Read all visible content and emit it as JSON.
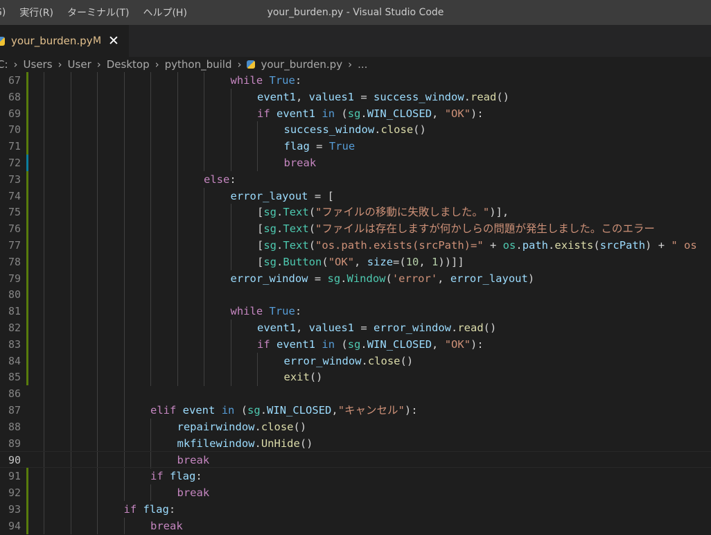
{
  "menu": [
    {
      "label": "G)"
    },
    {
      "label": "実行(R)"
    },
    {
      "label": "ターミナル(T)"
    },
    {
      "label": "ヘルプ(H)"
    }
  ],
  "window_title": "your_burden.py - Visual Studio Code",
  "tab": {
    "filename": "your_burden.py",
    "status": "M",
    "close": "✕"
  },
  "breadcrumb": [
    "C:",
    "Users",
    "User",
    "Desktop",
    "python_build",
    "your_burden.py",
    "..."
  ],
  "colors": {
    "keyword": "#c586c0",
    "constant": "#569cd6",
    "variable": "#9cdcfe",
    "function": "#dcdcaa",
    "class": "#4ec9b0",
    "string": "#ce9178",
    "number": "#b5cea8",
    "plain": "#d4d4d4"
  },
  "current_line": 90,
  "lines": [
    {
      "n": 67,
      "indent": 7,
      "gutter": "mod",
      "tokens": [
        [
          "keyword",
          "while"
        ],
        [
          "plain",
          " "
        ],
        [
          "constant",
          "True"
        ],
        [
          "plain",
          ":"
        ]
      ]
    },
    {
      "n": 68,
      "indent": 8,
      "gutter": "mod",
      "tokens": [
        [
          "variable",
          "event1"
        ],
        [
          "plain",
          ", "
        ],
        [
          "variable",
          "values1"
        ],
        [
          "plain",
          " = "
        ],
        [
          "variable",
          "success_window"
        ],
        [
          "plain",
          "."
        ],
        [
          "function",
          "read"
        ],
        [
          "plain",
          "()"
        ]
      ]
    },
    {
      "n": 69,
      "indent": 8,
      "gutter": "mod",
      "tokens": [
        [
          "keyword",
          "if"
        ],
        [
          "plain",
          " "
        ],
        [
          "variable",
          "event1"
        ],
        [
          "plain",
          " "
        ],
        [
          "constant",
          "in"
        ],
        [
          "plain",
          " ("
        ],
        [
          "class",
          "sg"
        ],
        [
          "plain",
          "."
        ],
        [
          "variable",
          "WIN_CLOSED"
        ],
        [
          "plain",
          ", "
        ],
        [
          "string",
          "\"OK\""
        ],
        [
          "plain",
          "):"
        ]
      ]
    },
    {
      "n": 70,
      "indent": 9,
      "gutter": "mod",
      "tokens": [
        [
          "variable",
          "success_window"
        ],
        [
          "plain",
          "."
        ],
        [
          "function",
          "close"
        ],
        [
          "plain",
          "()"
        ]
      ]
    },
    {
      "n": 71,
      "indent": 9,
      "gutter": "mod",
      "tokens": [
        [
          "variable",
          "flag"
        ],
        [
          "plain",
          " = "
        ],
        [
          "constant",
          "True"
        ]
      ]
    },
    {
      "n": 72,
      "indent": 9,
      "gutter": "add",
      "tokens": [
        [
          "keyword",
          "break"
        ]
      ]
    },
    {
      "n": 73,
      "indent": 6,
      "gutter": "mod",
      "tokens": [
        [
          "keyword",
          "else"
        ],
        [
          "plain",
          ":"
        ]
      ]
    },
    {
      "n": 74,
      "indent": 7,
      "gutter": "mod",
      "tokens": [
        [
          "variable",
          "error_layout"
        ],
        [
          "plain",
          " = ["
        ]
      ]
    },
    {
      "n": 75,
      "indent": 8,
      "gutter": "mod",
      "tokens": [
        [
          "plain",
          "["
        ],
        [
          "class",
          "sg"
        ],
        [
          "plain",
          "."
        ],
        [
          "class",
          "Text"
        ],
        [
          "plain",
          "("
        ],
        [
          "string",
          "\"ファイルの移動に失敗しました。\""
        ],
        [
          "plain",
          ")],"
        ]
      ]
    },
    {
      "n": 76,
      "indent": 8,
      "gutter": "mod",
      "tokens": [
        [
          "plain",
          "["
        ],
        [
          "class",
          "sg"
        ],
        [
          "plain",
          "."
        ],
        [
          "class",
          "Text"
        ],
        [
          "plain",
          "("
        ],
        [
          "string",
          "\"ファイルは存在しますが何かしらの問題が発生しました。このエラー"
        ]
      ]
    },
    {
      "n": 77,
      "indent": 8,
      "gutter": "mod",
      "tokens": [
        [
          "plain",
          "["
        ],
        [
          "class",
          "sg"
        ],
        [
          "plain",
          "."
        ],
        [
          "class",
          "Text"
        ],
        [
          "plain",
          "("
        ],
        [
          "string",
          "\"os.path.exists(srcPath)=\""
        ],
        [
          "plain",
          " + "
        ],
        [
          "class",
          "os"
        ],
        [
          "plain",
          "."
        ],
        [
          "variable",
          "path"
        ],
        [
          "plain",
          "."
        ],
        [
          "function",
          "exists"
        ],
        [
          "plain",
          "("
        ],
        [
          "variable",
          "srcPath"
        ],
        [
          "plain",
          ") + "
        ],
        [
          "string",
          "\" os"
        ]
      ]
    },
    {
      "n": 78,
      "indent": 8,
      "gutter": "mod",
      "tokens": [
        [
          "plain",
          "["
        ],
        [
          "class",
          "sg"
        ],
        [
          "plain",
          "."
        ],
        [
          "class",
          "Button"
        ],
        [
          "plain",
          "("
        ],
        [
          "string",
          "\"OK\""
        ],
        [
          "plain",
          ", "
        ],
        [
          "variable",
          "size"
        ],
        [
          "plain",
          "=("
        ],
        [
          "number",
          "10"
        ],
        [
          "plain",
          ", "
        ],
        [
          "number",
          "1"
        ],
        [
          "plain",
          "))]]"
        ]
      ]
    },
    {
      "n": 79,
      "indent": 7,
      "gutter": "mod",
      "tokens": [
        [
          "variable",
          "error_window"
        ],
        [
          "plain",
          " = "
        ],
        [
          "class",
          "sg"
        ],
        [
          "plain",
          "."
        ],
        [
          "class",
          "Window"
        ],
        [
          "plain",
          "("
        ],
        [
          "string",
          "'error'"
        ],
        [
          "plain",
          ", "
        ],
        [
          "variable",
          "error_layout"
        ],
        [
          "plain",
          ")"
        ]
      ]
    },
    {
      "n": 80,
      "indent": 7,
      "gutter": "mod",
      "tokens": []
    },
    {
      "n": 81,
      "indent": 7,
      "gutter": "mod",
      "tokens": [
        [
          "keyword",
          "while"
        ],
        [
          "plain",
          " "
        ],
        [
          "constant",
          "True"
        ],
        [
          "plain",
          ":"
        ]
      ]
    },
    {
      "n": 82,
      "indent": 8,
      "gutter": "mod",
      "tokens": [
        [
          "variable",
          "event1"
        ],
        [
          "plain",
          ", "
        ],
        [
          "variable",
          "values1"
        ],
        [
          "plain",
          " = "
        ],
        [
          "variable",
          "error_window"
        ],
        [
          "plain",
          "."
        ],
        [
          "function",
          "read"
        ],
        [
          "plain",
          "()"
        ]
      ]
    },
    {
      "n": 83,
      "indent": 8,
      "gutter": "mod",
      "tokens": [
        [
          "keyword",
          "if"
        ],
        [
          "plain",
          " "
        ],
        [
          "variable",
          "event1"
        ],
        [
          "plain",
          " "
        ],
        [
          "constant",
          "in"
        ],
        [
          "plain",
          " ("
        ],
        [
          "class",
          "sg"
        ],
        [
          "plain",
          "."
        ],
        [
          "variable",
          "WIN_CLOSED"
        ],
        [
          "plain",
          ", "
        ],
        [
          "string",
          "\"OK\""
        ],
        [
          "plain",
          "):"
        ]
      ]
    },
    {
      "n": 84,
      "indent": 9,
      "gutter": "mod",
      "tokens": [
        [
          "variable",
          "error_window"
        ],
        [
          "plain",
          "."
        ],
        [
          "function",
          "close"
        ],
        [
          "plain",
          "()"
        ]
      ]
    },
    {
      "n": 85,
      "indent": 9,
      "gutter": "mod",
      "tokens": [
        [
          "function",
          "exit"
        ],
        [
          "plain",
          "()"
        ]
      ]
    },
    {
      "n": 86,
      "indent": 0,
      "gutter": "",
      "tokens": []
    },
    {
      "n": 87,
      "indent": 4,
      "gutter": "",
      "tokens": [
        [
          "keyword",
          "elif"
        ],
        [
          "plain",
          " "
        ],
        [
          "variable",
          "event"
        ],
        [
          "plain",
          " "
        ],
        [
          "constant",
          "in"
        ],
        [
          "plain",
          " ("
        ],
        [
          "class",
          "sg"
        ],
        [
          "plain",
          "."
        ],
        [
          "variable",
          "WIN_CLOSED"
        ],
        [
          "plain",
          ","
        ],
        [
          "string",
          "\"キャンセル\""
        ],
        [
          "plain",
          "):"
        ]
      ]
    },
    {
      "n": 88,
      "indent": 5,
      "gutter": "",
      "tokens": [
        [
          "variable",
          "repairwindow"
        ],
        [
          "plain",
          "."
        ],
        [
          "function",
          "close"
        ],
        [
          "plain",
          "()"
        ]
      ]
    },
    {
      "n": 89,
      "indent": 5,
      "gutter": "",
      "tokens": [
        [
          "variable",
          "mkfilewindow"
        ],
        [
          "plain",
          "."
        ],
        [
          "function",
          "UnHide"
        ],
        [
          "plain",
          "()"
        ]
      ]
    },
    {
      "n": 90,
      "indent": 5,
      "gutter": "",
      "tokens": [
        [
          "keyword",
          "break"
        ]
      ]
    },
    {
      "n": 91,
      "indent": 4,
      "gutter": "mod",
      "tokens": [
        [
          "keyword",
          "if"
        ],
        [
          "plain",
          " "
        ],
        [
          "variable",
          "flag"
        ],
        [
          "plain",
          ":"
        ]
      ]
    },
    {
      "n": 92,
      "indent": 5,
      "gutter": "mod",
      "tokens": [
        [
          "keyword",
          "break"
        ]
      ]
    },
    {
      "n": 93,
      "indent": 3,
      "gutter": "mod",
      "tokens": [
        [
          "keyword",
          "if"
        ],
        [
          "plain",
          " "
        ],
        [
          "variable",
          "flag"
        ],
        [
          "plain",
          ":"
        ]
      ]
    },
    {
      "n": 94,
      "indent": 4,
      "gutter": "mod",
      "tokens": [
        [
          "keyword",
          "break"
        ]
      ]
    }
  ]
}
